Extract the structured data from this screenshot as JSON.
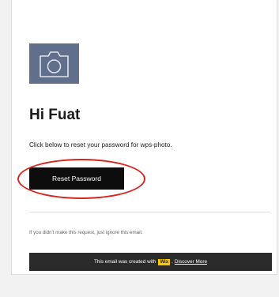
{
  "email": {
    "logo_icon": "camera-icon",
    "greeting": "Hi Fuat",
    "intro": "Click below to reset your password for wps-photo.",
    "reset_button_label": "Reset Password",
    "ignore_note": "If you didn't make this request, just ignore this email.",
    "footer": {
      "created_with": "This email was created with",
      "brand_badge": "Wix",
      "separator": ".",
      "link_label": "Discover More"
    }
  },
  "colors": {
    "logo_bg": "#5f6f8c",
    "button_bg": "#0d0d0d",
    "footer_bg": "#2a2a2a",
    "annotation": "#d9231f",
    "brand_badge": "#ffc800"
  }
}
